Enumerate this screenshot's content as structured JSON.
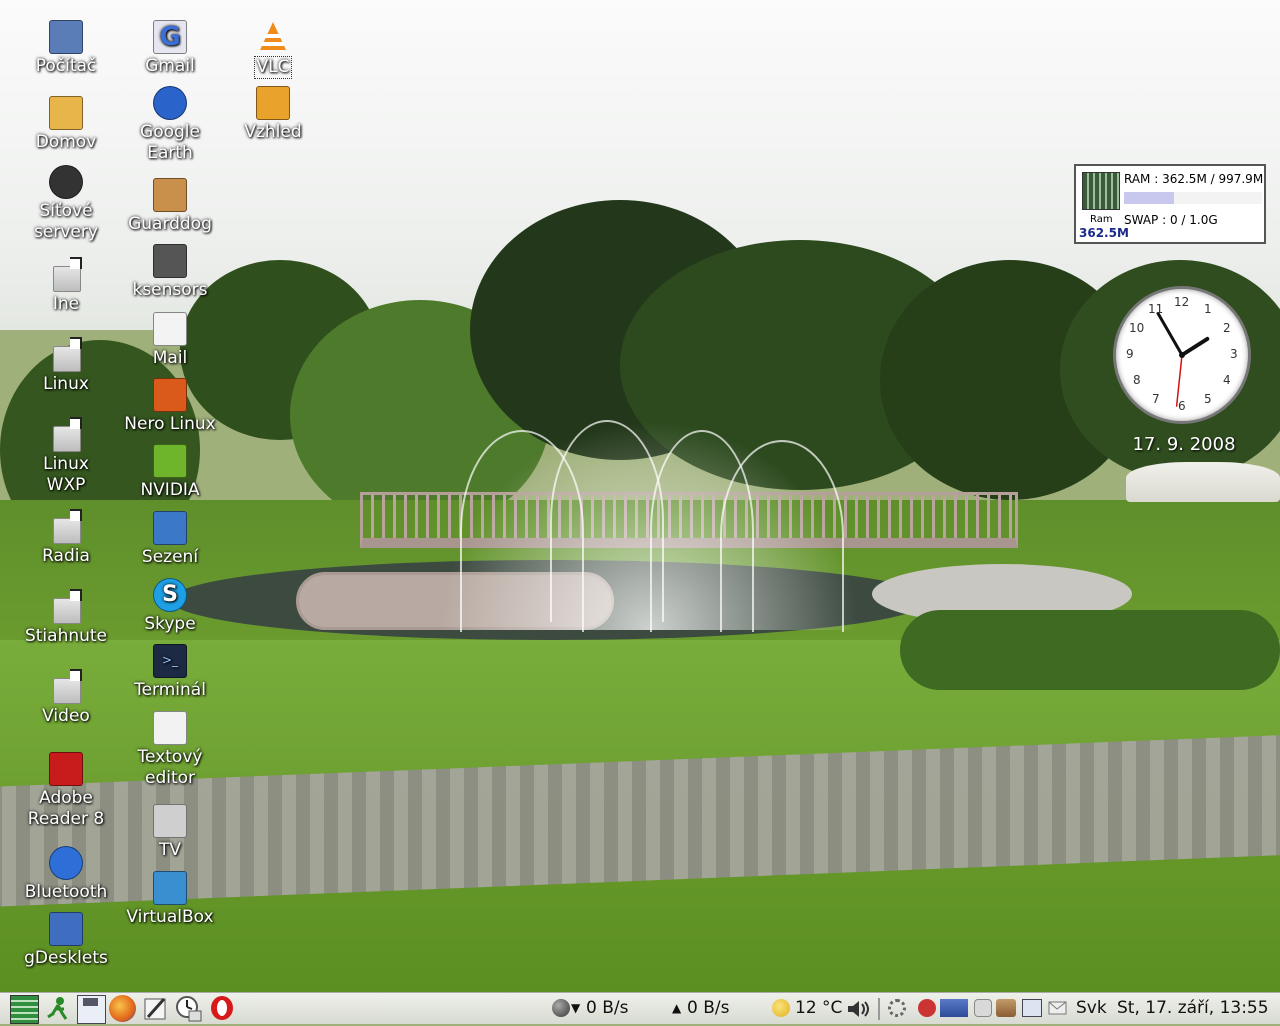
{
  "desktop_icons": {
    "col1": [
      {
        "label": "Počítač",
        "icon": "computer-icon"
      },
      {
        "label": "Domov",
        "icon": "home-folder-icon"
      },
      {
        "label": "Síťové\nservery",
        "icon": "network-icon"
      },
      {
        "label": "Ine",
        "icon": "folder-link-icon"
      },
      {
        "label": "Linux",
        "icon": "folder-link-icon"
      },
      {
        "label": "Linux\nWXP",
        "icon": "folder-link-icon"
      },
      {
        "label": "Radia",
        "icon": "folder-link-icon"
      },
      {
        "label": "Stiahnute",
        "icon": "folder-link-icon"
      },
      {
        "label": "Video",
        "icon": "folder-link-icon"
      },
      {
        "label": "Adobe\nReader 8",
        "icon": "adobe-reader-icon"
      },
      {
        "label": "Bluetooth",
        "icon": "bluetooth-icon"
      },
      {
        "label": "gDesklets",
        "icon": "puzzle-icon"
      }
    ],
    "col2": [
      {
        "label": "Gmail",
        "icon": "gmail-icon"
      },
      {
        "label": "Google\nEarth",
        "icon": "globe-icon"
      },
      {
        "label": "Guarddog",
        "icon": "dog-icon"
      },
      {
        "label": "ksensors",
        "icon": "chip-icon"
      },
      {
        "label": "Mail",
        "icon": "mail-icon"
      },
      {
        "label": "Nero Linux",
        "icon": "nero-icon"
      },
      {
        "label": "NVIDIA",
        "icon": "nvidia-icon"
      },
      {
        "label": "Sezení",
        "icon": "session-icon"
      },
      {
        "label": "Skype",
        "icon": "skype-icon"
      },
      {
        "label": "Terminál",
        "icon": "terminal-icon"
      },
      {
        "label": "Textový\neditor",
        "icon": "text-editor-icon"
      },
      {
        "label": "TV",
        "icon": "tv-icon"
      },
      {
        "label": "VirtualBox",
        "icon": "virtualbox-icon"
      }
    ],
    "col3": [
      {
        "label": "VLC",
        "icon": "vlc-icon",
        "selected": true
      },
      {
        "label": "Vzhled",
        "icon": "color-palette-icon"
      }
    ]
  },
  "ram_widget": {
    "ram_text": "RAM : 362.5M / 997.9M",
    "swap_text": "SWAP : 0 / 1.0G",
    "chip_label": "Ram",
    "used_label": "362.5M",
    "ram_fraction": 0.363
  },
  "clock": {
    "date": "17. 9. 2008",
    "numbers": [
      "12",
      "1",
      "2",
      "3",
      "4",
      "5",
      "6",
      "7",
      "8",
      "9",
      "10",
      "11"
    ],
    "hour": 1,
    "minute": 55,
    "second": 31
  },
  "taskbar": {
    "launchers": [
      "show-desktop-icon",
      "run-icon",
      "save-icon",
      "firefox-icon",
      "text-editor-icon",
      "clock-app-icon",
      "opera-icon"
    ],
    "net_down": "0 B/s",
    "net_up": "0 B/s",
    "weather": "12 °C",
    "keyboard": "Svk",
    "datetime": "St, 17. září, 13:55"
  },
  "colors": {
    "taskbar_bg": "#e2e5dd",
    "icon_text": "#ffffff",
    "ram_bar": "#c8c8ee",
    "clock_second_hand": "#d11111"
  }
}
